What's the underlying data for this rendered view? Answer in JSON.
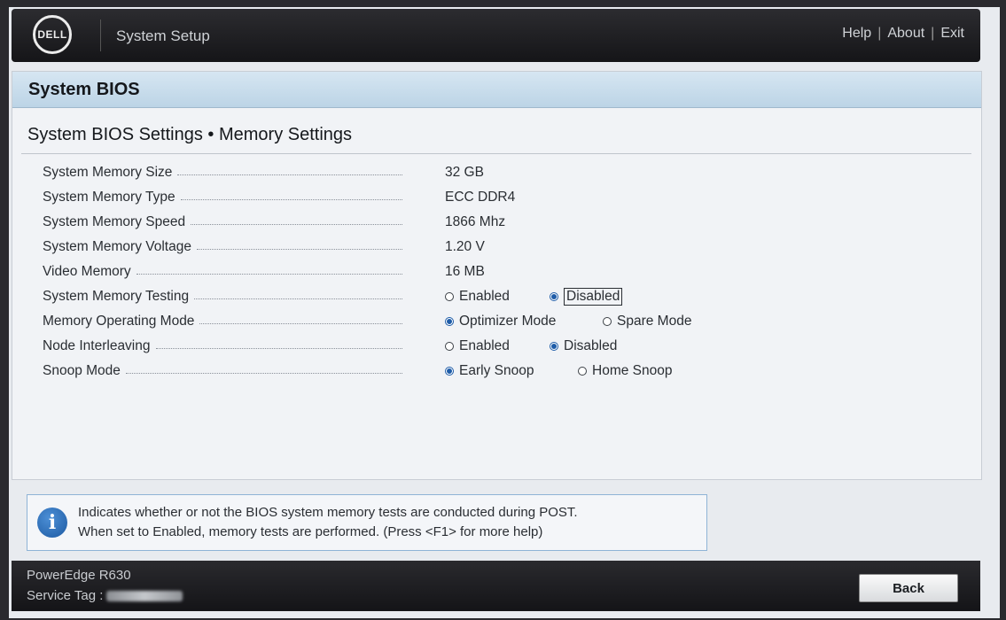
{
  "header": {
    "logo_text": "DELL",
    "app_title": "System Setup",
    "links": [
      "Help",
      "About",
      "Exit"
    ]
  },
  "panel": {
    "title": "System BIOS",
    "section_title": "System BIOS Settings • Memory Settings"
  },
  "settings": [
    {
      "label": "System Memory Size",
      "value": "32 GB"
    },
    {
      "label": "System Memory Type",
      "value": "ECC DDR4"
    },
    {
      "label": "System Memory Speed",
      "value": "1866 Mhz"
    },
    {
      "label": "System Memory Voltage",
      "value": "1.20 V"
    },
    {
      "label": "Video Memory",
      "value": "16 MB"
    },
    {
      "label": "System Memory Testing",
      "options": [
        "Enabled",
        "Disabled"
      ],
      "selected": "Disabled"
    },
    {
      "label": "Memory Operating Mode",
      "options": [
        "Optimizer Mode",
        "Spare Mode"
      ],
      "selected": "Optimizer Mode"
    },
    {
      "label": "Node Interleaving",
      "options": [
        "Enabled",
        "Disabled"
      ],
      "selected": "Disabled"
    },
    {
      "label": "Snoop Mode",
      "options": [
        "Early Snoop",
        "Home Snoop"
      ],
      "selected": "Early Snoop"
    }
  ],
  "help": {
    "line1": "Indicates whether or not the BIOS system memory tests are conducted during POST.",
    "line2": "When set to Enabled, memory tests are performed. (Press <F1> for more help)"
  },
  "footer": {
    "model": "PowerEdge R630",
    "service_tag_label": "Service Tag :",
    "back_label": "Back"
  },
  "colors": {
    "header_bg": "#1c1c20",
    "panel_title_bg": "#c8dcec",
    "radio_selected": "#1e5ca8",
    "help_border": "#8fb4d6"
  },
  "icons": {
    "logo": "dell-logo",
    "info": "info-icon"
  }
}
